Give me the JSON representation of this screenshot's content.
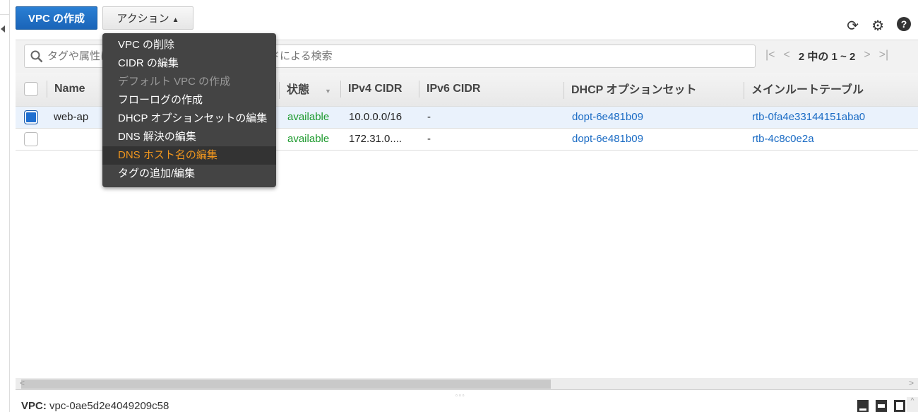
{
  "toolbar": {
    "create_vpc": "VPC の作成",
    "actions": "アクション",
    "actions_caret": "▲"
  },
  "icons": {
    "refresh": "⟳",
    "settings": "⚙",
    "help": "?"
  },
  "search": {
    "placeholder": "タグや属性によるフィルター、またはキーワードによる検索"
  },
  "pager": {
    "first": "|<",
    "prev": "<",
    "text": "2 中の 1 ~ 2",
    "next": ">",
    "last": ">|"
  },
  "table": {
    "headers": [
      "Name",
      "状態",
      "IPv4 CIDR",
      "IPv6 CIDR",
      "DHCP オプションセット",
      "メインルートテーブル"
    ],
    "rows": [
      {
        "selected": true,
        "name": "web-ap",
        "state": "available",
        "ipv4": "10.0.0.0/16",
        "ipv6": "-",
        "dhcp": "dopt-6e481b09",
        "route": "rtb-0fa4e33144151aba0"
      },
      {
        "selected": false,
        "name": "",
        "state": "available",
        "ipv4": "172.31.0....",
        "ipv6": "-",
        "dhcp": "dopt-6e481b09",
        "route": "rtb-4c8c0e2a"
      }
    ]
  },
  "menu": {
    "items": [
      "VPC の削除",
      "CIDR の編集",
      "デフォルト VPC の作成",
      "フローログの作成",
      "DHCP オプションセットの編集",
      "DNS 解決の編集",
      "DNS ホスト名の編集",
      "タグの追加/編集"
    ],
    "disabled_index": 2,
    "highlighted_index": 6
  },
  "footer": {
    "label": "VPC:",
    "value": "vpc-0ae5d2e4049209c58"
  },
  "colors": {
    "primary": "#1f6fd0",
    "available": "#1d9a2e",
    "link": "#1a6bc4",
    "menu_highlight": "#f0961e"
  }
}
